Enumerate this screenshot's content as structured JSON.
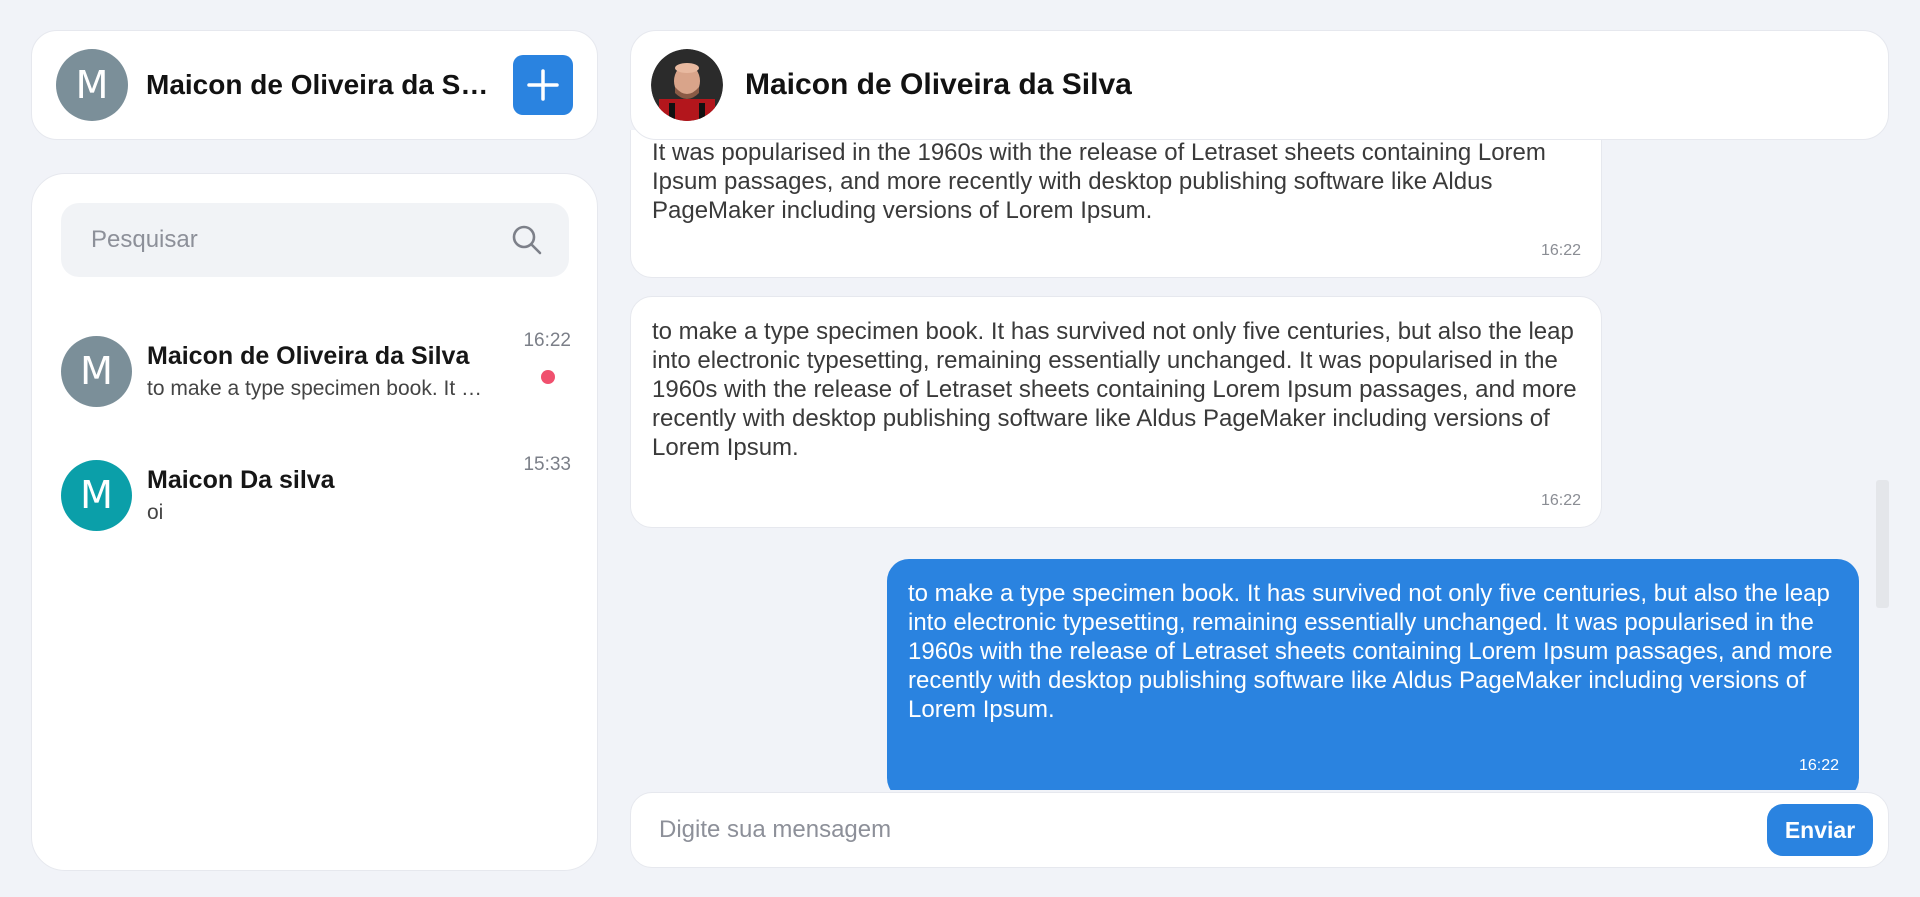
{
  "colors": {
    "accent": "#2a83e0",
    "unread": "#f0506e",
    "avatar_gray": "#7b8f99",
    "avatar_teal": "#0b9fa9"
  },
  "profile": {
    "initial": "M",
    "name": "Maicon de Oliveira da Silva",
    "new_chat_icon": "plus-icon"
  },
  "search": {
    "placeholder": "Pesquisar",
    "icon": "search-icon"
  },
  "conversations": [
    {
      "initial": "M",
      "name": "Maicon de Oliveira da Silva",
      "preview": "to make a type specimen book. It has survived not only five centuries",
      "time": "16:22",
      "unread": true
    },
    {
      "initial": "M",
      "name": "Maicon Da silva",
      "preview": "oi",
      "time": "15:33",
      "unread": false
    }
  ],
  "chat": {
    "title": "Maicon de Oliveira da Silva",
    "avatar_icon": "contact-photo-icon",
    "messages": [
      {
        "direction": "in",
        "text": "It was popularised in the 1960s with the release of Letraset sheets containing Lorem Ipsum passages, and more recently with desktop publishing software like Aldus PageMaker including versions of Lorem Ipsum.",
        "time": "16:22"
      },
      {
        "direction": "in",
        "text": "to make a type specimen book. It has survived not only five centuries, but also the leap into electronic typesetting, remaining essentially unchanged. It was popularised in the 1960s with the release of Letraset sheets containing Lorem Ipsum passages, and more recently with desktop publishing software like Aldus PageMaker including versions of Lorem Ipsum.",
        "time": "16:22"
      },
      {
        "direction": "out",
        "text": "to make a type specimen book. It has survived not only five centuries, but also the leap into electronic typesetting, remaining essentially unchanged. It was popularised in the 1960s with the release of Letraset sheets containing Lorem Ipsum passages, and more recently with desktop publishing software like Aldus PageMaker including versions of Lorem Ipsum.",
        "time": "16:22"
      }
    ]
  },
  "composer": {
    "placeholder": "Digite sua mensagem",
    "send_label": "Enviar"
  }
}
